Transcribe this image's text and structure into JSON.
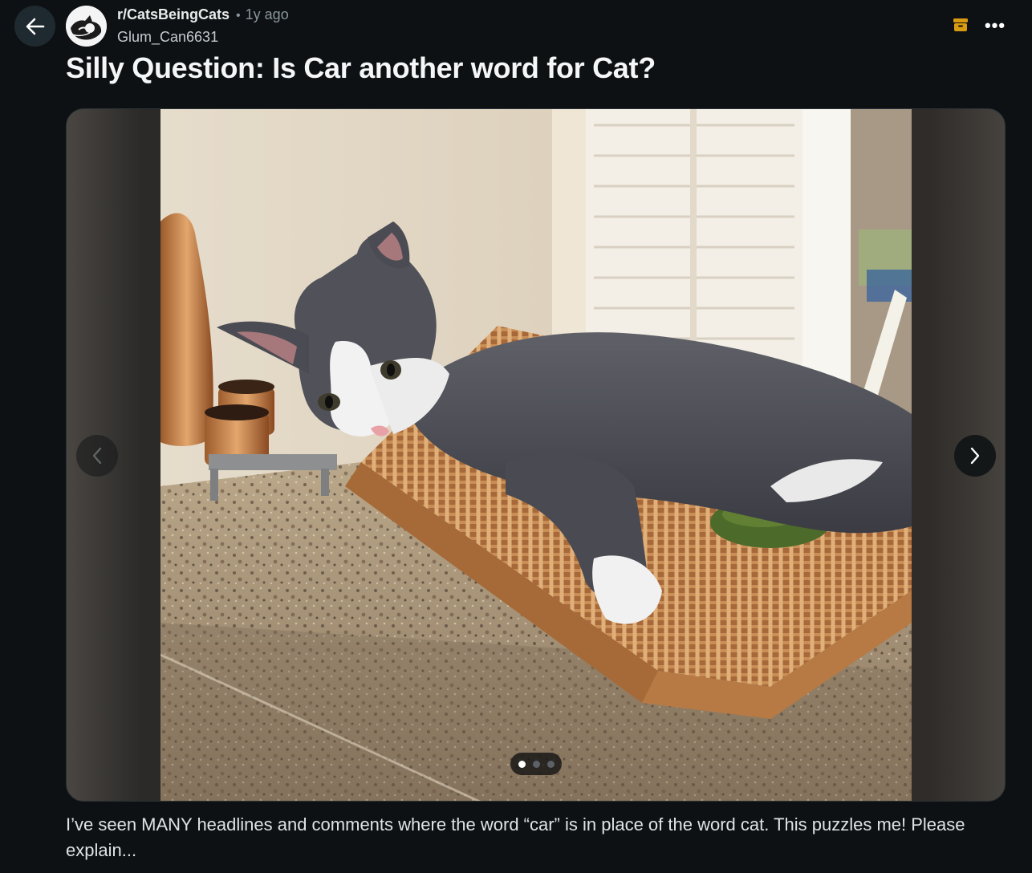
{
  "header": {
    "subreddit": "r/CatsBeingCats",
    "separator": "•",
    "age": "1y ago",
    "username": "Glum_Can6631",
    "more_label": "•••"
  },
  "post": {
    "title": "Silly Question: Is Car another word for Cat?",
    "body": "I’ve seen MANY headlines and comments where the word “car” is in place of the word cat. This puzzles me! Please explain..."
  },
  "gallery": {
    "current_index": 1,
    "total": 3
  },
  "colors": {
    "background": "#0e1113",
    "archive_icon": "#d99b12"
  },
  "icons": {
    "back": "arrow-left-icon",
    "archive": "archive-box-icon",
    "more": "ellipsis-icon",
    "prev": "chevron-left-icon",
    "next": "chevron-right-icon"
  }
}
